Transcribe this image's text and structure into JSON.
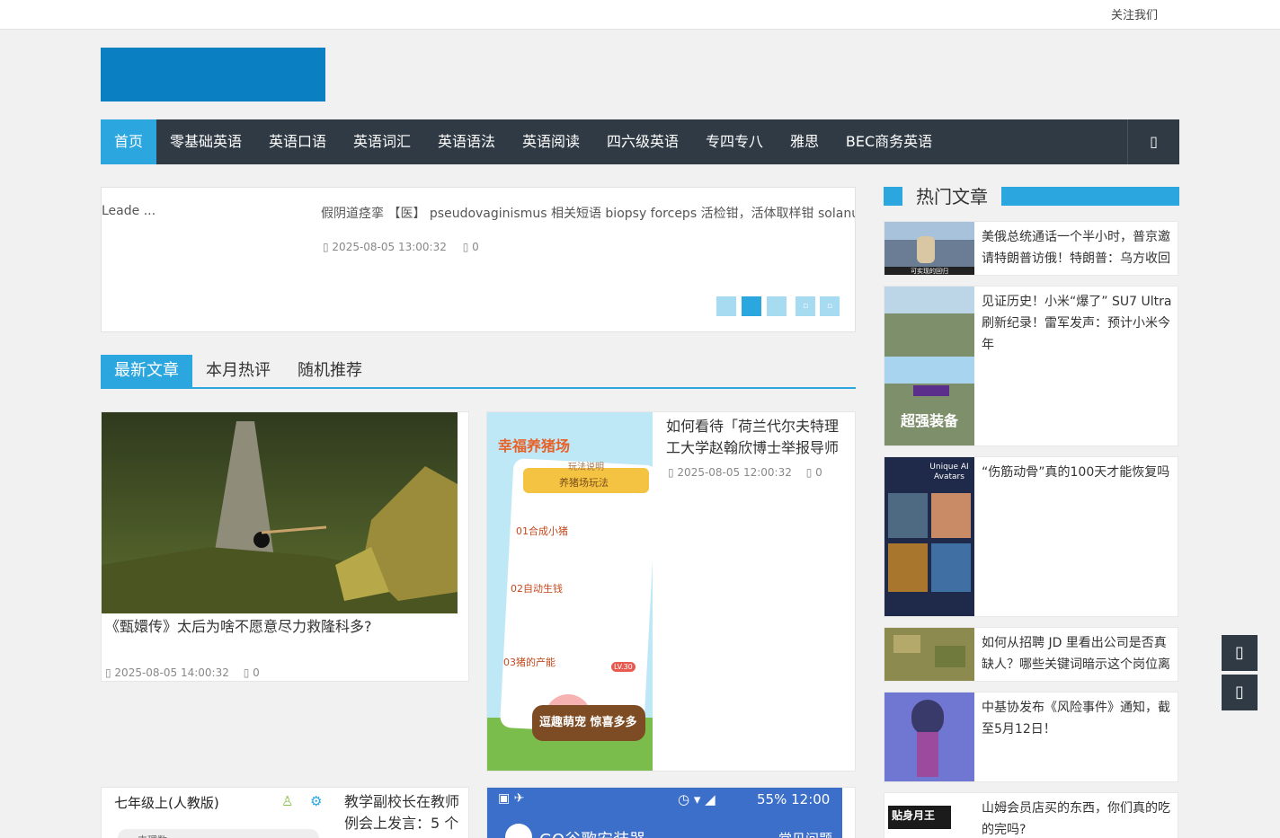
{
  "topbar": {
    "follow": "关注我们"
  },
  "nav": {
    "items": [
      "首页",
      "零基础英语",
      "英语口语",
      "英语词汇",
      "英语语法",
      "英语阅读",
      "四六级英语",
      "专四专八",
      "雅思",
      "BEC商务英语"
    ],
    "search_icon": "▯"
  },
  "slider": {
    "left_fragment": "Leade ...",
    "title": "假阴道痉挛 【医】 pseudovaginismus 相关短语 biopsy forceps 活检钳，活体取样钳 solanum",
    "meta_time": "▯ 2025-08-05 13:00:32",
    "meta_comments": "▯ 0",
    "dot_icon": "▫"
  },
  "tabs": [
    "最新文章",
    "本月热评",
    "随机推荐"
  ],
  "posts": [
    {
      "title": "《甄嬛传》太后为啥不愿意尽力救隆科多?",
      "time": "▯ 2025-08-05 14:00:32",
      "comments": "▯ 0"
    },
    {
      "title": "如何看待「荷兰代尔夫特理工大学赵翰欣博士举报导师",
      "time": "▯ 2025-08-05 12:00:32",
      "comments": "▯ 0"
    },
    {
      "title": "教学副校长在教师例会上发言：5 个",
      "thumb_header": "七年级上(人教版)",
      "thumb_sub": "丰理数"
    },
    {
      "title": "",
      "thumb_status": "55%  12:00",
      "thumb_app": "GO谷歌安装器",
      "thumb_faq": "常见问题"
    }
  ],
  "game_thumb": {
    "logo": "幸福养猪场",
    "subtitle": "玩法说明",
    "banner": "养猪场玩法",
    "step1": "01合成小猪",
    "step2": "02自动生钱",
    "step3": "03猪的产能",
    "slogan": "逗趣萌宠 惊喜多多",
    "badge": "LV.30"
  },
  "sidebar": {
    "title": "热门文章",
    "items": [
      {
        "text": "美俄总统通话一个半小时，普京邀请特朗普访俄！特朗普：乌方收回",
        "thumb_caption": "可实现的回归"
      },
      {
        "text": "见证历史！小米“爆了” SU7 Ultra刷新纪录！雷军发声：预计小米今年",
        "thumb_caption": "超强装备"
      },
      {
        "text": "“伤筋动骨”真的100天才能恢复吗",
        "thumb_caption": "Unique AI Avatars"
      },
      {
        "text": "如何从招聘 JD 里看出公司是否真缺人？哪些关键词暗示这个岗位离"
      },
      {
        "text": "中基协发布《风险事件》通知，截至5月12日！"
      },
      {
        "text": "山姆会员店买的东西，你们真的吃的完吗?",
        "thumb_caption": "贴身月王"
      }
    ]
  },
  "float_buttons": {
    "top_icon": "▯",
    "bottom_icon": "▯"
  }
}
